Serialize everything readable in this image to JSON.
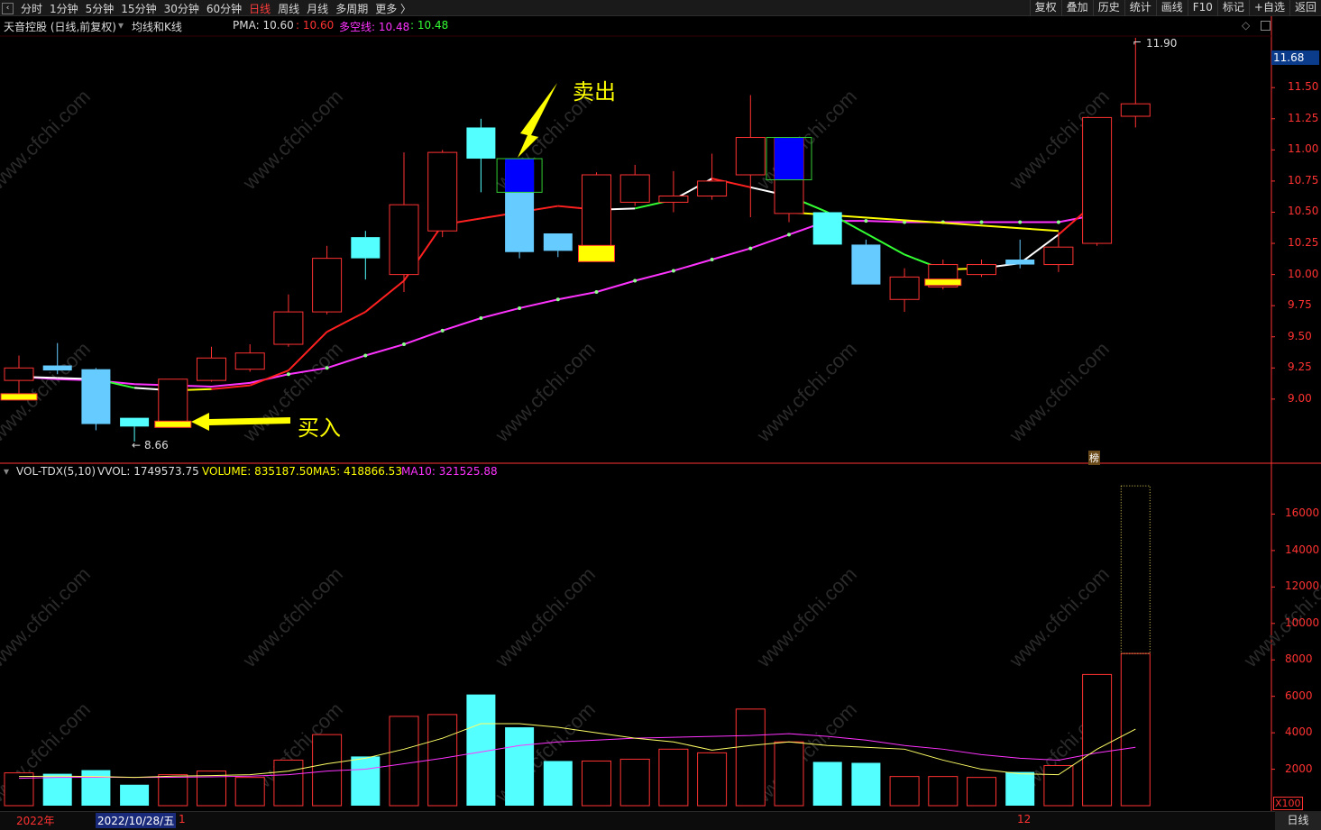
{
  "toolbar": {
    "left": [
      "分时",
      "1分钟",
      "5分钟",
      "15分钟",
      "30分钟",
      "60分钟",
      "日线",
      "周线",
      "月线",
      "多周期",
      "更多 〉"
    ],
    "active": "日线",
    "right": [
      "复权",
      "叠加",
      "历史",
      "统计",
      "画线",
      "F10",
      "标记",
      "+自选",
      "返回"
    ]
  },
  "main_chart": {
    "stock": "天音控股 (日线,前复权)",
    "indicator": "均线和K线",
    "pma_label": "PMA: 10.60",
    "pma_red": ": 10.60",
    "dk_label": "多空线: 10.48",
    "dk_green": ": 10.48",
    "current_price": "11.68",
    "high_label": "11.90",
    "low_label": "8.66",
    "bang": "榜",
    "sell": "卖出",
    "buy": "买入",
    "watermark": "www.cfchi.com",
    "y_ticks": [
      "11.50",
      "11.25",
      "11.00",
      "10.75",
      "10.50",
      "10.25",
      "10.00",
      "9.75",
      "9.50",
      "9.25",
      "9.00"
    ]
  },
  "volume_panel": {
    "title": "VOL-TDX(5,10)",
    "vvol": "VVOL: 1749573.75",
    "volume": "VOLUME: 835187.50",
    "ma5": "MA5: 418866.53",
    "ma10": "MA10: 321525.88",
    "y_ticks": [
      "16000",
      "14000",
      "12000",
      "10000",
      "8000",
      "6000",
      "4000",
      "2000"
    ],
    "multiplier": "X100"
  },
  "bottom": {
    "year": "2022年",
    "date": "2022/10/28/五",
    "day": "1",
    "month": "12",
    "period": "日线"
  },
  "colors": {
    "up": "#ff3232",
    "down": "#54ffff",
    "down_light": "#66ccff",
    "ma_fast": "#ff2020",
    "ma_slow": "#ff33ff",
    "yellow": "#ffff00",
    "sell_box": "#0000ff"
  },
  "chart_data": {
    "type": "candlestick",
    "price_ylim": [
      8.5,
      11.95
    ],
    "volume_ylim": [
      0,
      18000
    ],
    "candles": [
      {
        "o": 9.15,
        "c": 9.25,
        "h": 9.35,
        "l": 9.0,
        "vol": 1800
      },
      {
        "o": 9.27,
        "c": 9.23,
        "h": 9.45,
        "l": 9.2,
        "vol": 1750
      },
      {
        "o": 9.24,
        "c": 8.8,
        "h": 9.25,
        "l": 8.75,
        "vol": 1950
      },
      {
        "o": 8.85,
        "c": 8.78,
        "h": 8.85,
        "l": 8.66,
        "vol": 1150
      },
      {
        "o": 8.8,
        "c": 9.16,
        "h": 9.16,
        "l": 8.78,
        "vol": 1700
      },
      {
        "o": 9.15,
        "c": 9.33,
        "h": 9.42,
        "l": 9.14,
        "vol": 1900
      },
      {
        "o": 9.24,
        "c": 9.37,
        "h": 9.44,
        "l": 9.22,
        "vol": 1550
      },
      {
        "o": 9.44,
        "c": 9.7,
        "h": 9.84,
        "l": 9.42,
        "vol": 2500
      },
      {
        "o": 9.7,
        "c": 10.13,
        "h": 10.23,
        "l": 9.68,
        "vol": 3900
      },
      {
        "o": 10.3,
        "c": 10.13,
        "h": 10.35,
        "l": 9.96,
        "vol": 2700
      },
      {
        "o": 10.0,
        "c": 10.56,
        "h": 10.98,
        "l": 9.86,
        "vol": 4900
      },
      {
        "o": 10.35,
        "c": 10.98,
        "h": 11.0,
        "l": 10.3,
        "vol": 5000
      },
      {
        "o": 11.18,
        "c": 10.93,
        "h": 11.25,
        "l": 10.66,
        "vol": 6100
      },
      {
        "o": 10.9,
        "c": 10.18,
        "h": 10.92,
        "l": 10.13,
        "vol": 4300
      },
      {
        "o": 10.33,
        "c": 10.19,
        "h": 10.33,
        "l": 10.14,
        "vol": 2450
      },
      {
        "o": 10.2,
        "c": 10.8,
        "h": 10.82,
        "l": 10.18,
        "vol": 2450
      },
      {
        "o": 10.58,
        "c": 10.8,
        "h": 10.88,
        "l": 10.55,
        "vol": 2550
      },
      {
        "o": 10.58,
        "c": 10.63,
        "h": 10.83,
        "l": 10.5,
        "vol": 3100
      },
      {
        "o": 10.63,
        "c": 10.75,
        "h": 10.97,
        "l": 10.6,
        "vol": 2900
      },
      {
        "o": 10.8,
        "c": 11.1,
        "h": 11.44,
        "l": 10.46,
        "vol": 5300
      },
      {
        "o": 10.49,
        "c": 11.1,
        "h": 11.1,
        "l": 10.42,
        "vol": 3500
      },
      {
        "o": 10.5,
        "c": 10.24,
        "h": 10.5,
        "l": 10.24,
        "vol": 2400
      },
      {
        "o": 10.24,
        "c": 9.92,
        "h": 10.28,
        "l": 9.92,
        "vol": 2350
      },
      {
        "o": 9.8,
        "c": 9.98,
        "h": 10.05,
        "l": 9.7,
        "vol": 1600
      },
      {
        "o": 9.9,
        "c": 10.08,
        "h": 10.12,
        "l": 9.88,
        "vol": 1600
      },
      {
        "o": 10.0,
        "c": 10.08,
        "h": 10.12,
        "l": 9.98,
        "vol": 1550
      },
      {
        "o": 10.12,
        "c": 10.08,
        "h": 10.28,
        "l": 10.05,
        "vol": 1850
      },
      {
        "o": 10.08,
        "c": 10.22,
        "h": 10.34,
        "l": 10.02,
        "vol": 2200
      },
      {
        "o": 10.25,
        "c": 11.26,
        "h": 11.26,
        "l": 10.23,
        "vol": 7200
      },
      {
        "o": 11.27,
        "c": 11.37,
        "h": 11.9,
        "l": 11.18,
        "vol": 8350
      }
    ],
    "vol_limit_bar": 17550,
    "ma_fast": [
      9.18,
      9.17,
      9.16,
      9.09,
      9.07,
      9.08,
      9.11,
      9.23,
      9.54,
      9.7,
      9.95,
      10.4,
      10.45,
      10.5,
      10.55,
      10.52,
      10.53,
      10.6,
      10.77,
      10.7,
      10.63,
      10.5,
      10.33,
      10.16,
      10.04,
      10.05,
      10.09,
      10.32,
      10.59
    ],
    "ma_slow": [
      9.18,
      9.16,
      9.15,
      9.12,
      9.11,
      9.1,
      9.13,
      9.2,
      9.25,
      9.35,
      9.44,
      9.55,
      9.65,
      9.73,
      9.8,
      9.86,
      9.95,
      10.03,
      10.12,
      10.21,
      10.32,
      10.43,
      10.43,
      10.42,
      10.42,
      10.42,
      10.42,
      10.42,
      10.48
    ],
    "ma5_vol": [
      1600,
      1620,
      1600,
      1550,
      1620,
      1650,
      1700,
      1900,
      2300,
      2600,
      3100,
      3700,
      4500,
      4500,
      4300,
      4000,
      3700,
      3500,
      3050,
      3300,
      3500,
      3300,
      3200,
      3100,
      2500,
      2000,
      1750,
      1700,
      3100,
      4200
    ],
    "ma10_vol": [
      1500,
      1550,
      1560,
      1550,
      1560,
      1580,
      1620,
      1700,
      1900,
      2000,
      2300,
      2600,
      2950,
      3300,
      3500,
      3600,
      3700,
      3750,
      3800,
      3850,
      3950,
      3800,
      3600,
      3300,
      3100,
      2800,
      2600,
      2500,
      2900,
      3200
    ]
  }
}
